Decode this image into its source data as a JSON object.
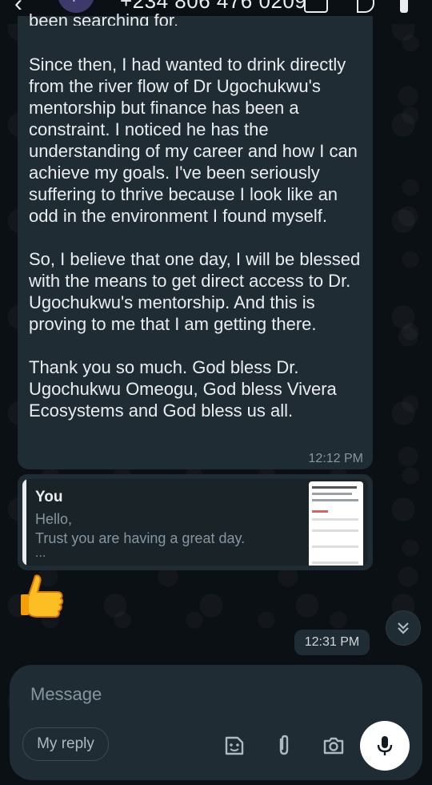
{
  "header": {
    "avatar_letter": "+",
    "contact_number": "+234 806 476 0209"
  },
  "incoming_message": {
    "cutoff_line": "been searching for.",
    "body": "Since then, I had wanted to drink directly from the river flow of Dr Ugochukwu's mentorship but finance has been a constraint. I noticed he has the understanding of my career and how I can achieve my goals. I've been seriously suffering to thrive because I look like an odd in the environment I found myself.\n\nSo, I believe that one day, I will be blessed with the means to get direct access to Dr. Ugochukwu's mentorship. And this is proving to me that I am getting there.\n\nThank you so much. God bless Dr. Ugochukwu Omeogu, God bless Vivera Ecosystems and God bless us all.",
    "time": "12:12 PM"
  },
  "reply_message": {
    "quoted_author": "You",
    "quoted_line1": "Hello,",
    "quoted_line2": "Trust you are having a great day.",
    "quoted_ellipsis": "..."
  },
  "reaction_message": {
    "emoji": "thumbs-up-icon",
    "time": "12:31 PM"
  },
  "composer": {
    "placeholder": "Message",
    "my_reply_label": "My reply",
    "icons": [
      "sticker-icon",
      "attach-icon",
      "camera-icon",
      "mic-icon"
    ]
  },
  "colors": {
    "background": "#0b1014",
    "bubble": "#202c33",
    "text": "#e9edef",
    "meta": "#8696a0",
    "thumb": "#fbbf24"
  }
}
